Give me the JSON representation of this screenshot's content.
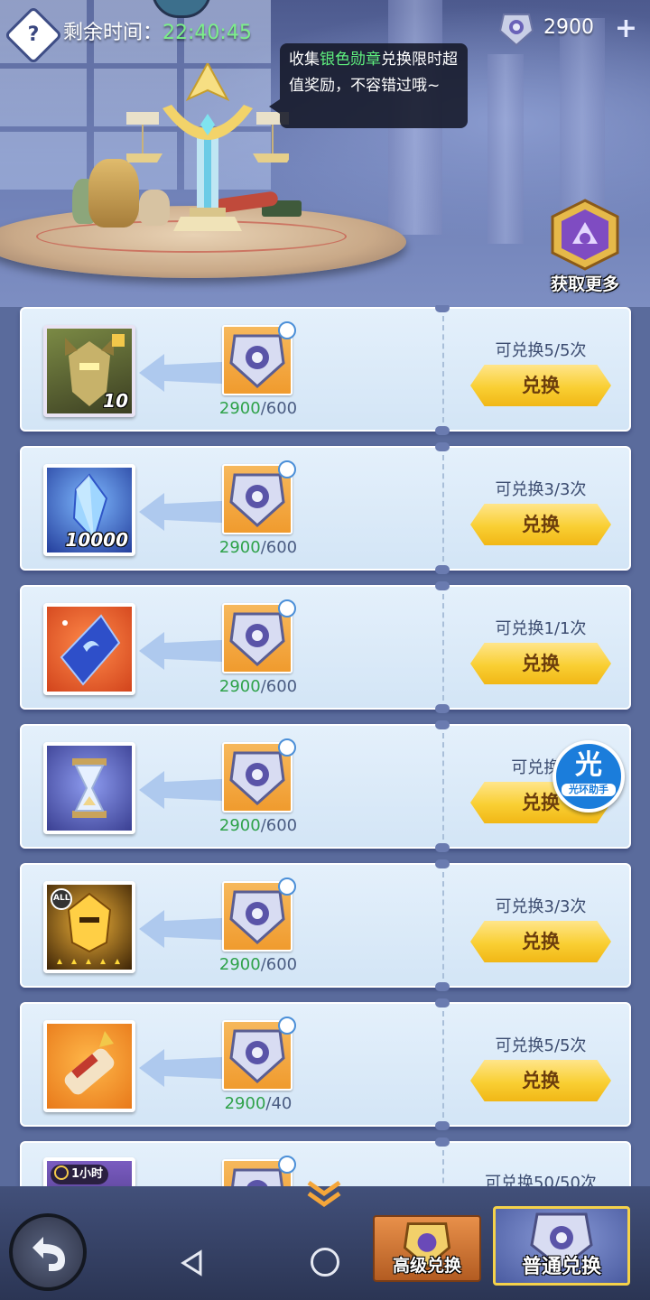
{
  "header": {
    "help_label": "?",
    "timer_label": "剩余时间：",
    "timer_value": "22:40:45",
    "currency_amount": "2900",
    "currency_plus": "+",
    "tooltip_pre": "收集",
    "tooltip_highlight": "银色勋章",
    "tooltip_post": "兑换限时超值奖励，不容错过哦~",
    "get_more_label": "获取更多"
  },
  "exchange_button_label": "兑换",
  "items": [
    {
      "icon": "hero-fragment-icon",
      "qty": "10",
      "have": "2900",
      "need": "600",
      "remaining": "可兑换5/5次"
    },
    {
      "icon": "blue-crystal-icon",
      "qty": "10000",
      "have": "2900",
      "need": "600",
      "remaining": "可兑换3/3次"
    },
    {
      "icon": "blue-gem-icon",
      "qty": "",
      "have": "2900",
      "need": "600",
      "remaining": "可兑换1/1次"
    },
    {
      "icon": "hourglass-icon",
      "qty": "",
      "have": "2900",
      "need": "600",
      "remaining": "可兑换1"
    },
    {
      "icon": "golden-helmet-icon",
      "qty": "",
      "have": "2900",
      "need": "600",
      "remaining": "可兑换3/3次",
      "badge": "ALL"
    },
    {
      "icon": "scroll-icon",
      "qty": "",
      "have": "2900",
      "need": "40",
      "remaining": "可兑换5/5次"
    },
    {
      "icon": "time-item-icon",
      "qty": "",
      "badge": "1小时",
      "remaining": "可兑换50/50次"
    }
  ],
  "helper": {
    "big": "光",
    "small": "光环助手"
  },
  "tabs": {
    "advanced": "高级兑换",
    "normal": "普通兑换"
  },
  "colors": {
    "have": "#2fa24a",
    "button": "#f9cf33",
    "highlight": "#5ff07e"
  }
}
